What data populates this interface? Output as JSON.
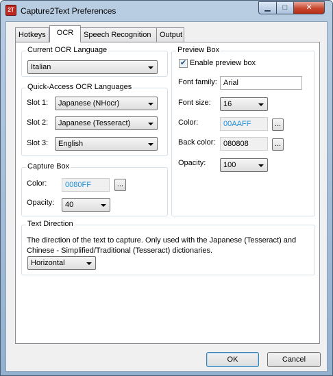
{
  "window": {
    "title": "Capture2Text Preferences",
    "app_icon_text": "2T"
  },
  "titlebar_buttons": {
    "minimize": "▁",
    "maximize": "□",
    "close": "✕"
  },
  "tabs": [
    {
      "label": "Hotkeys"
    },
    {
      "label": "OCR"
    },
    {
      "label": "Speech Recognition"
    },
    {
      "label": "Output"
    }
  ],
  "ocr": {
    "current_language": {
      "title": "Current OCR Language",
      "value": "Italian"
    },
    "quick_access": {
      "title": "Quick-Access OCR Languages",
      "slots": [
        {
          "label": "Slot 1:",
          "value": "Japanese (NHocr)"
        },
        {
          "label": "Slot 2:",
          "value": "Japanese (Tesseract)"
        },
        {
          "label": "Slot 3:",
          "value": "English"
        }
      ]
    },
    "capture_box": {
      "title": "Capture Box",
      "color_label": "Color:",
      "color_value": "0080FF",
      "color_button": "...",
      "opacity_label": "Opacity:",
      "opacity_value": "40"
    },
    "preview_box": {
      "title": "Preview Box",
      "enable_label": "Enable preview box",
      "enable_checked": "✔",
      "font_family_label": "Font family:",
      "font_family_value": "Arial",
      "font_size_label": "Font size:",
      "font_size_value": "16",
      "color_label": "Color:",
      "color_value": "00AAFF",
      "color_button": "...",
      "back_color_label": "Back color:",
      "back_color_value": "080808",
      "back_color_button": "...",
      "opacity_label": "Opacity:",
      "opacity_value": "100"
    },
    "text_direction": {
      "title": "Text Direction",
      "description": "The direction of the text to capture. Only used with the Japanese (Tesseract) and Chinese - Simplified/Traditional (Tesseract) dictionaries.",
      "value": "Horizontal"
    }
  },
  "buttons": {
    "ok": "OK",
    "cancel": "Cancel"
  }
}
